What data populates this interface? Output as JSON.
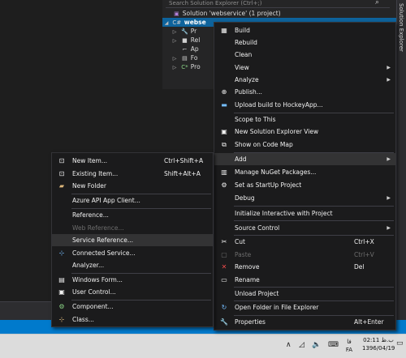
{
  "solution_explorer": {
    "search_placeholder": "Search Solution Explorer (Ctrl+;)",
    "solution_label": "Solution 'webservice' (1 project)",
    "project_label": "webse",
    "children": [
      "Pr",
      "Rel",
      "Ap",
      "Fo",
      "Pro"
    ],
    "side_tab_label": "Solution Explorer"
  },
  "context_menu": {
    "items": [
      {
        "label": "Build",
        "icon": "build-icon",
        "enabled": true
      },
      {
        "label": "Rebuild",
        "icon": "",
        "enabled": true
      },
      {
        "label": "Clean",
        "icon": "",
        "enabled": true
      },
      {
        "label": "View",
        "icon": "",
        "enabled": true,
        "submenu": true
      },
      {
        "label": "Analyze",
        "icon": "",
        "enabled": true,
        "submenu": true
      },
      {
        "label": "Publish...",
        "icon": "publish-icon",
        "enabled": true
      },
      {
        "label": "Upload build to HockeyApp...",
        "icon": "hockeyapp-icon",
        "enabled": true
      },
      {
        "label": "Scope to This",
        "icon": "",
        "enabled": true
      },
      {
        "label": "New Solution Explorer View",
        "icon": "new-view-icon",
        "enabled": true
      },
      {
        "label": "Show on Code Map",
        "icon": "code-map-icon",
        "enabled": true
      },
      {
        "label": "Add",
        "icon": "",
        "enabled": true,
        "submenu": true,
        "highlighted": true
      },
      {
        "label": "Manage NuGet Packages...",
        "icon": "nuget-icon",
        "enabled": true
      },
      {
        "label": "Set as StartUp Project",
        "icon": "gear-icon",
        "enabled": true
      },
      {
        "label": "Debug",
        "icon": "",
        "enabled": true,
        "submenu": true
      },
      {
        "label": "Initialize Interactive with Project",
        "icon": "",
        "enabled": true
      },
      {
        "label": "Source Control",
        "icon": "",
        "enabled": true,
        "submenu": true
      },
      {
        "label": "Cut",
        "icon": "cut-icon",
        "shortcut": "Ctrl+X",
        "enabled": true
      },
      {
        "label": "Paste",
        "icon": "paste-icon",
        "shortcut": "Ctrl+V",
        "enabled": false
      },
      {
        "label": "Remove",
        "icon": "remove-icon",
        "shortcut": "Del",
        "enabled": true
      },
      {
        "label": "Rename",
        "icon": "rename-icon",
        "enabled": true
      },
      {
        "label": "Unload Project",
        "icon": "",
        "enabled": true
      },
      {
        "label": "Open Folder in File Explorer",
        "icon": "open-folder-icon",
        "enabled": true
      },
      {
        "label": "Properties",
        "icon": "properties-icon",
        "shortcut": "Alt+Enter",
        "enabled": true
      }
    ]
  },
  "add_submenu": {
    "items": [
      {
        "label": "New Item...",
        "icon": "new-item-icon",
        "shortcut": "Ctrl+Shift+A",
        "enabled": true
      },
      {
        "label": "Existing Item...",
        "icon": "existing-item-icon",
        "shortcut": "Shift+Alt+A",
        "enabled": true
      },
      {
        "label": "New Folder",
        "icon": "new-folder-icon",
        "enabled": true
      },
      {
        "label": "Azure API App Client...",
        "icon": "",
        "enabled": true
      },
      {
        "label": "Reference...",
        "icon": "",
        "enabled": true
      },
      {
        "label": "Web Reference...",
        "icon": "",
        "enabled": false
      },
      {
        "label": "Service Reference...",
        "icon": "",
        "enabled": true,
        "highlighted": true
      },
      {
        "label": "Connected Service...",
        "icon": "connected-service-icon",
        "enabled": true
      },
      {
        "label": "Analyzer...",
        "icon": "",
        "enabled": true
      },
      {
        "label": "Windows Form...",
        "icon": "windows-form-icon",
        "enabled": true
      },
      {
        "label": "User Control...",
        "icon": "user-control-icon",
        "enabled": true
      },
      {
        "label": "Component...",
        "icon": "component-icon",
        "enabled": true
      },
      {
        "label": "Class...",
        "icon": "class-icon",
        "enabled": true
      }
    ]
  },
  "taskbar": {
    "language_label": "FA",
    "language_script": "فا",
    "clock_time": "02:11 ب.ظ",
    "clock_date": "1396/04/19"
  }
}
